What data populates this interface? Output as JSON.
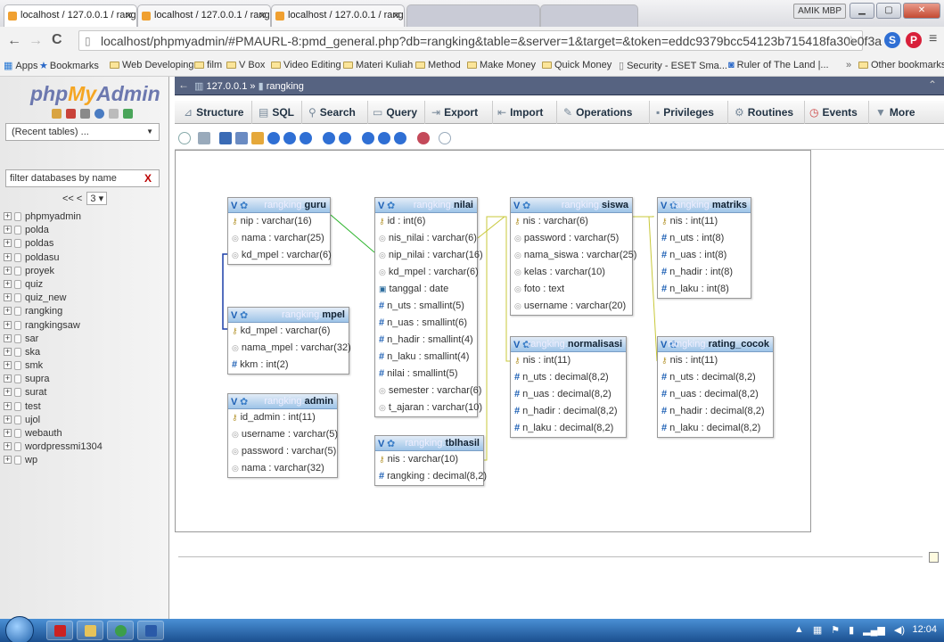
{
  "browser": {
    "tabs": [
      {
        "label": "localhost / 127.0.0.1 / rang"
      },
      {
        "label": "localhost / 127.0.0.1 / rang"
      },
      {
        "label": "localhost / 127.0.0.1 / rang"
      }
    ],
    "profile_label": "AMIK MBP",
    "url": "localhost/phpmyadmin/#PMAURL-8:pmd_general.php?db=rangking&table=&server=1&target=&token=eddc9379bcc54123b715418fa30e0f3a",
    "bookmarks": [
      "Apps",
      "Bookmarks",
      "Web Developing",
      "film",
      "V Box",
      "Video Editing",
      "Materi Kuliah",
      "Method",
      "Make Money",
      "Quick Money",
      "Security - ESET Sma...",
      "Ruler of The Land |...",
      "Other bookmarks"
    ],
    "overflow": "»"
  },
  "left_panel": {
    "logo_php": "php",
    "logo_my": "My",
    "logo_admin": "Admin",
    "recent_tables": "(Recent tables) ...",
    "filter_placeholder": "filter databases by name",
    "filter_clear": "X",
    "pager_prev": "<< <",
    "pager_page": "3",
    "databases": [
      "phpmyadmin",
      "polda",
      "poldas",
      "poldasu",
      "proyek",
      "quiz",
      "quiz_new",
      "rangking",
      "rangkingsaw",
      "sar",
      "ska",
      "smk",
      "supra",
      "surat",
      "test",
      "ujol",
      "webauth",
      "wordpressmi1304",
      "wp"
    ]
  },
  "breadcrumb": {
    "server": "127.0.0.1",
    "sep": "»",
    "db": "rangking"
  },
  "menu": [
    "Structure",
    "SQL",
    "Search",
    "Query",
    "Export",
    "Import",
    "Operations",
    "Privileges",
    "Routines",
    "Events",
    "More"
  ],
  "tables": {
    "db_prefix": "rangking.",
    "guru": {
      "name": "guru",
      "cols": [
        "nip : varchar(16)",
        "nama : varchar(25)",
        "kd_mpel : varchar(6)"
      ]
    },
    "nilai": {
      "name": "nilai",
      "cols": [
        "id : int(6)",
        "nis_nilai : varchar(6)",
        "nip_nilai : varchar(16)",
        "kd_mpel : varchar(6)",
        "tanggal : date",
        "n_uts : smallint(5)",
        "n_uas : smallint(6)",
        "n_hadir : smallint(4)",
        "n_laku : smallint(4)",
        "nilai : smallint(5)",
        "semester : varchar(6)",
        "t_ajaran : varchar(10)"
      ]
    },
    "siswa": {
      "name": "siswa",
      "cols": [
        "nis : varchar(6)",
        "password : varchar(5)",
        "nama_siswa : varchar(25)",
        "kelas : varchar(10)",
        "foto : text",
        "username : varchar(20)"
      ]
    },
    "matriks": {
      "name": "matriks",
      "cols": [
        "nis : int(11)",
        "n_uts : int(8)",
        "n_uas : int(8)",
        "n_hadir : int(8)",
        "n_laku : int(8)"
      ]
    },
    "mpel": {
      "name": "mpel",
      "cols": [
        "kd_mpel : varchar(6)",
        "nama_mpel : varchar(32)",
        "kkm : int(2)"
      ]
    },
    "normalisasi": {
      "name": "normalisasi",
      "cols": [
        "nis : int(11)",
        "n_uts : decimal(8,2)",
        "n_uas : decimal(8,2)",
        "n_hadir : decimal(8,2)",
        "n_laku : decimal(8,2)"
      ]
    },
    "rating_cocok": {
      "name": "rating_cocok",
      "cols": [
        "nis : int(11)",
        "n_uts : decimal(8,2)",
        "n_uas : decimal(8,2)",
        "n_hadir : decimal(8,2)",
        "n_laku : decimal(8,2)"
      ]
    },
    "admin": {
      "name": "admin",
      "cols": [
        "id_admin : int(11)",
        "username : varchar(5)",
        "password : varchar(5)",
        "nama : varchar(32)"
      ]
    },
    "tblhasil": {
      "name": "tblhasil",
      "cols": [
        "nis : varchar(10)",
        "rangking : decimal(8,2)"
      ]
    }
  },
  "taskbar": {
    "clock": "12:04"
  },
  "colors": {
    "link_green": "#2db52d",
    "link_blue": "#1b3fa8",
    "link_yellow": "#c8c83a",
    "header_blue": "#9ec4e8",
    "breadcrumb_bg": "#566381"
  }
}
